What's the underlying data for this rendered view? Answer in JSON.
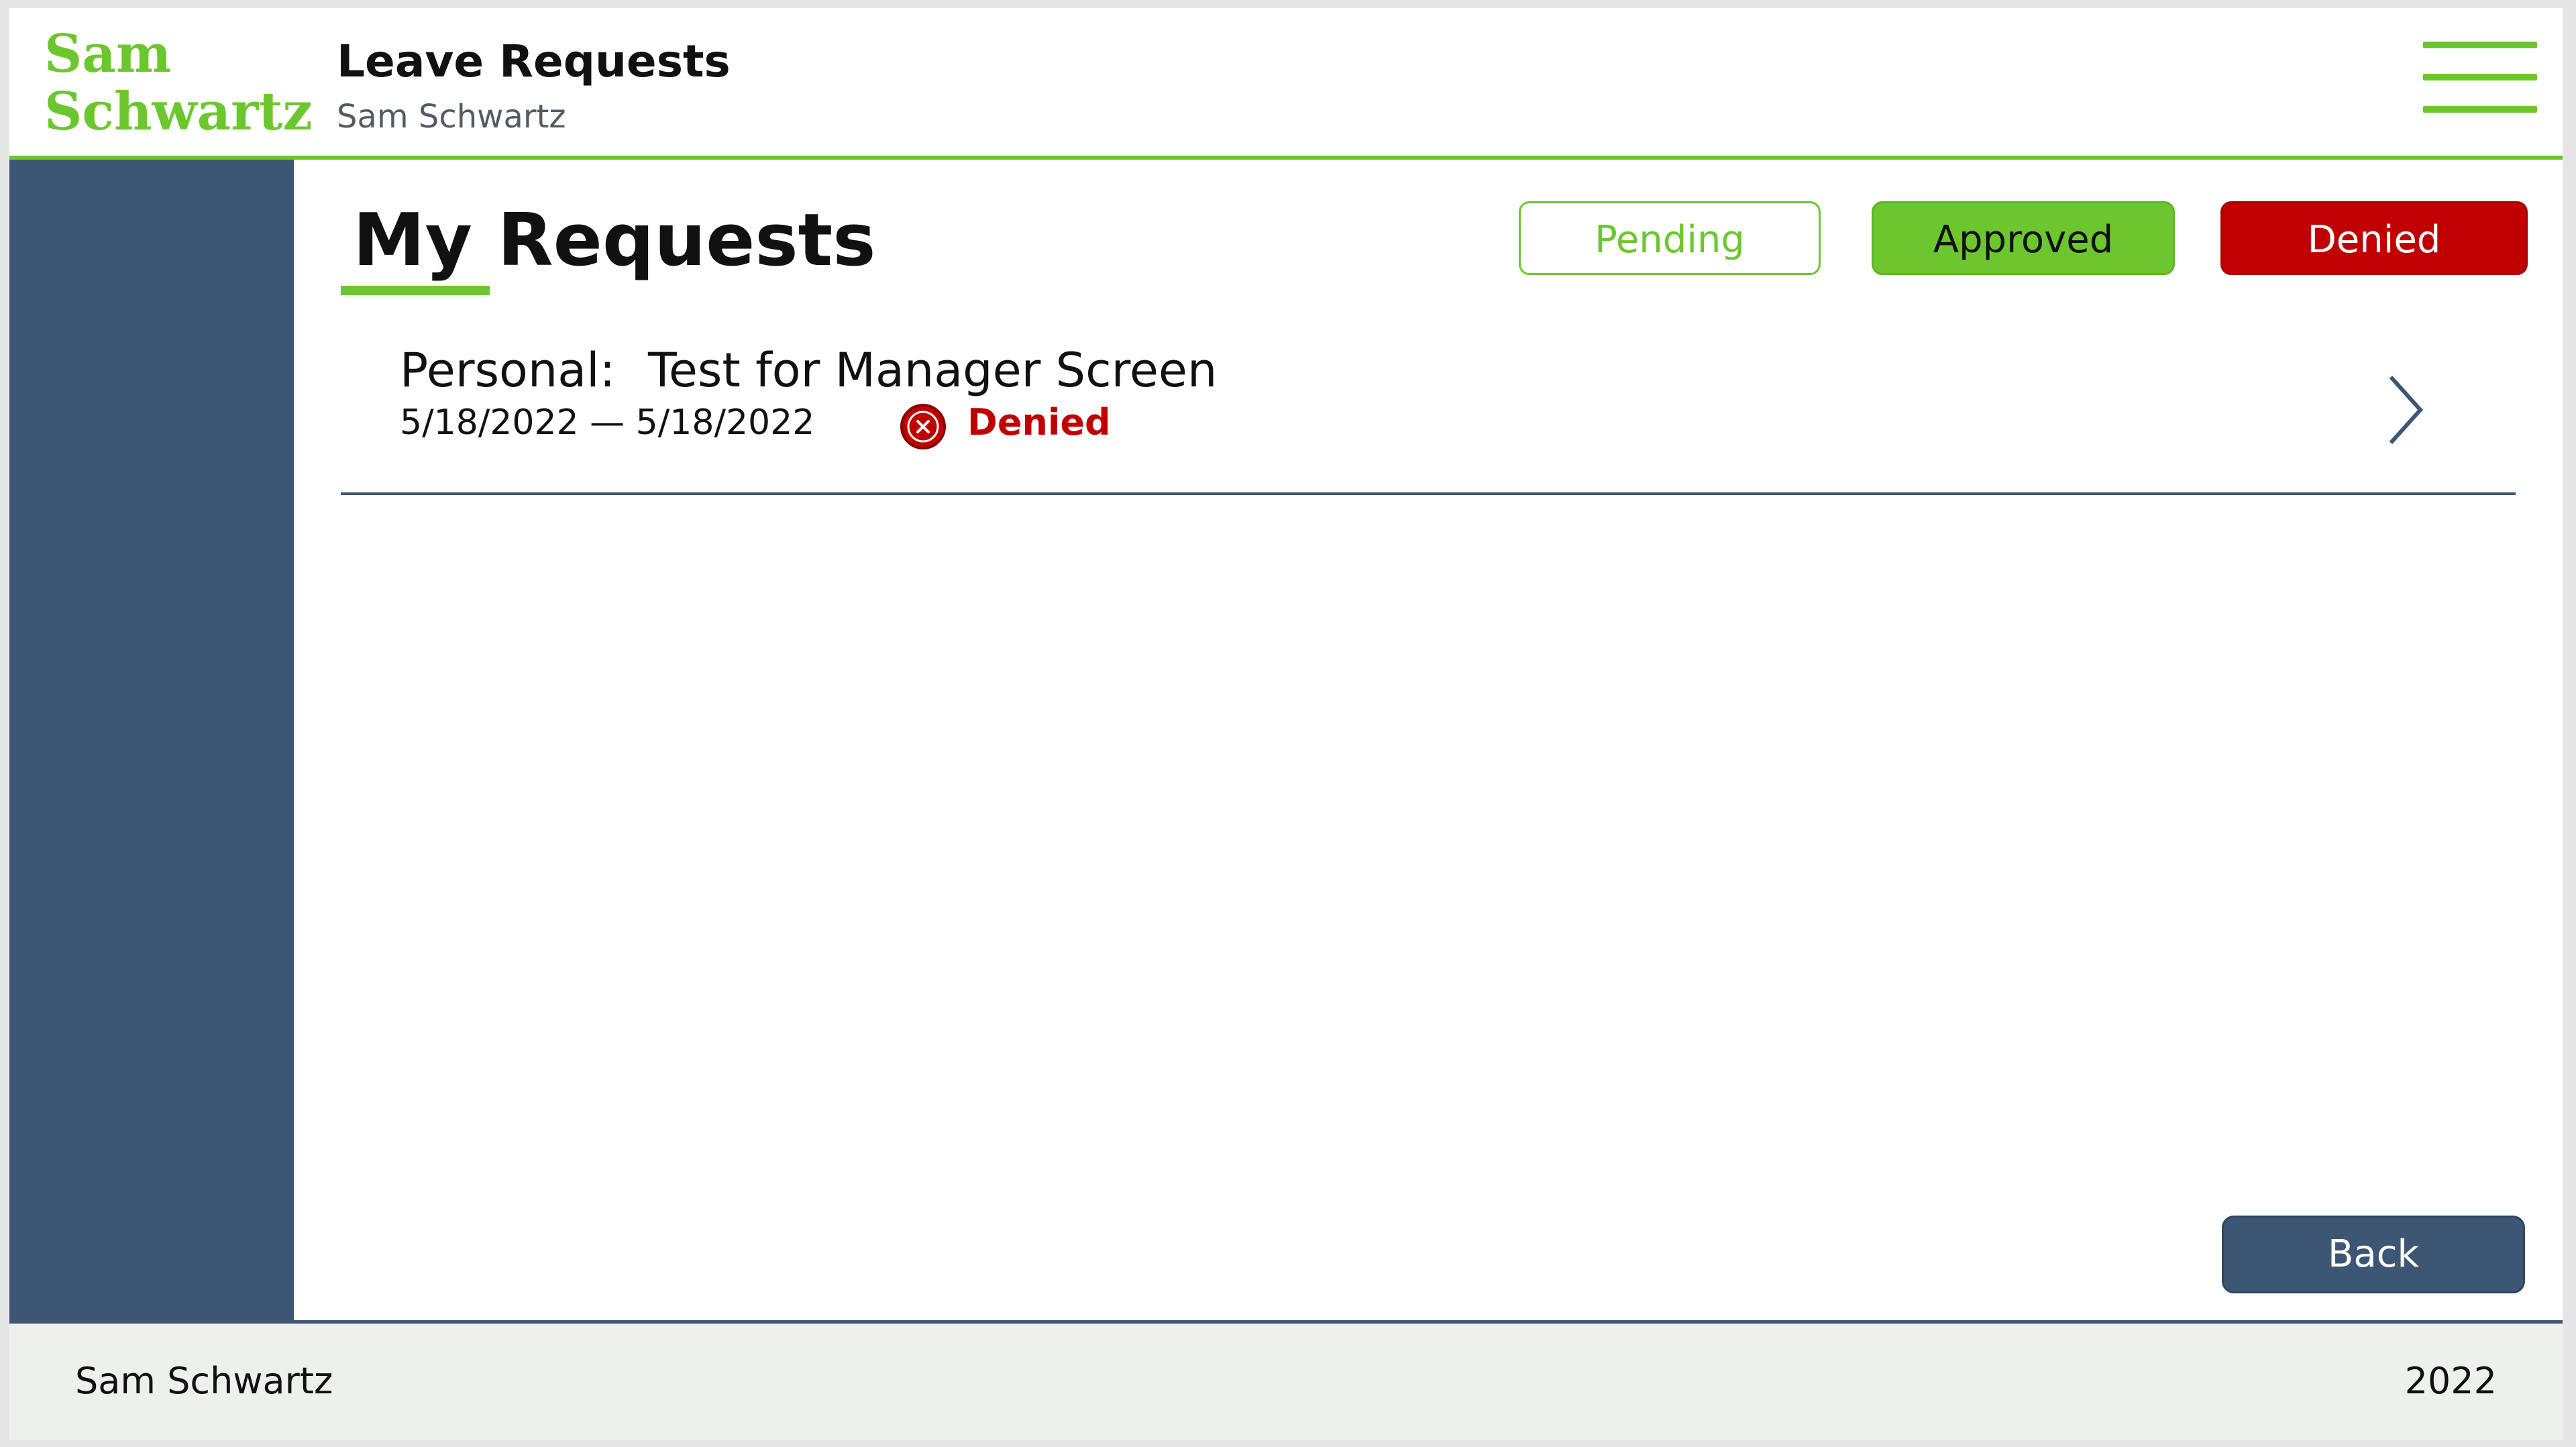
{
  "header": {
    "logo_line1": "Sam",
    "logo_line2": "Schwartz",
    "title": "Leave Requests",
    "subtitle": "Sam Schwartz",
    "menu_icon": "hamburger-menu-icon"
  },
  "main": {
    "title": "My Requests",
    "filters": {
      "pending": "Pending",
      "approved": "Approved",
      "denied": "Denied"
    },
    "requests": [
      {
        "type": "Personal:",
        "name": "Test for Manager Screen",
        "dates": "5/18/2022 — 5/18/2022",
        "status": "Denied",
        "status_icon": "x-circle-icon"
      }
    ],
    "back_label": "Back"
  },
  "footer": {
    "left": "Sam Schwartz",
    "right": "2022"
  },
  "colors": {
    "accent_green": "#6cc72f",
    "navy": "#3d5673",
    "denied_red": "#c00000",
    "footer_bg": "#eef0ee"
  }
}
